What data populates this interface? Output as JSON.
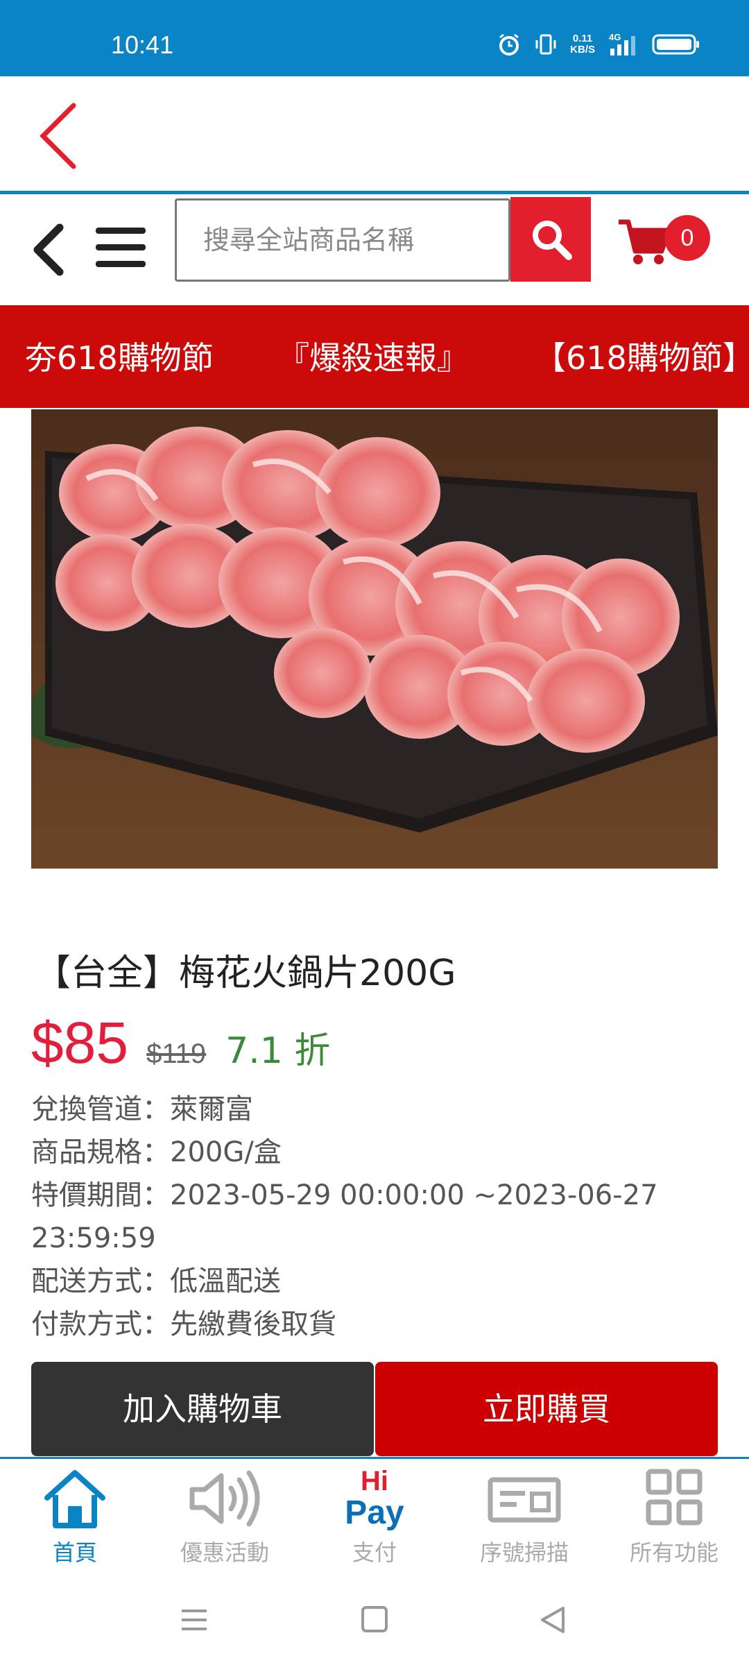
{
  "status": {
    "time": "10:41",
    "net_speed_value": "0.11",
    "net_speed_unit": "KB/S",
    "network_type": "4G"
  },
  "colors": {
    "brand_blue": "#0b84c6",
    "brand_red": "#e31e2d",
    "price_red": "#e31e3c",
    "discount_green": "#3b8a3b"
  },
  "search": {
    "placeholder": "搜尋全站商品名稱"
  },
  "cart": {
    "count": "0"
  },
  "marquee": {
    "items": [
      "夯618購物節",
      "『爆殺速報』",
      "【618購物節】"
    ]
  },
  "product": {
    "title": "【台全】梅花火鍋片200G",
    "price": "$85",
    "original_price": "$119",
    "discount": "7.1 折",
    "details": [
      "兌換管道：萊爾富",
      "商品規格：200G/盒",
      "特價期間：2023-05-29 00:00:00 ~2023-06-27 23:59:59",
      "配送方式：低溫配送",
      "付款方式：先繳費後取貨"
    ]
  },
  "actions": {
    "add_to_cart": "加入購物車",
    "buy_now": "立即購買"
  },
  "tabs": [
    {
      "label": "首頁",
      "icon": "home-icon"
    },
    {
      "label": "優惠活動",
      "icon": "speaker-icon"
    },
    {
      "label": "支付",
      "icon": "hipay-icon",
      "logo_top": "Hi",
      "logo_bottom": "Pay"
    },
    {
      "label": "序號掃描",
      "icon": "scan-icon"
    },
    {
      "label": "所有功能",
      "icon": "grid-icon"
    }
  ]
}
